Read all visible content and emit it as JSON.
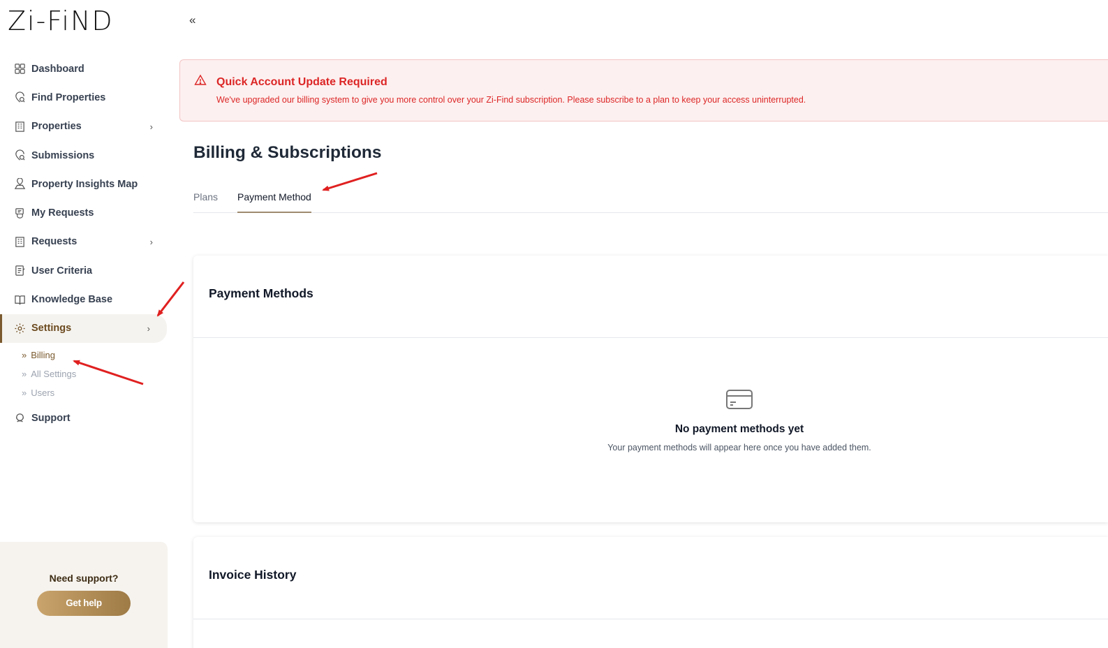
{
  "app": {
    "logo": "Zi-FiND"
  },
  "sidebar": {
    "items": [
      {
        "label": "Dashboard",
        "icon": "grid-icon",
        "chevron": false
      },
      {
        "label": "Find Properties",
        "icon": "location-search-icon",
        "chevron": false
      },
      {
        "label": "Properties",
        "icon": "building-icon",
        "chevron": true
      },
      {
        "label": "Submissions",
        "icon": "location-search-icon",
        "chevron": false
      },
      {
        "label": "Property Insights Map",
        "icon": "map-icon",
        "chevron": false
      },
      {
        "label": "My Requests",
        "icon": "request-icon",
        "chevron": false
      },
      {
        "label": "Requests",
        "icon": "building-icon",
        "chevron": true
      },
      {
        "label": "User Criteria",
        "icon": "criteria-icon",
        "chevron": false
      },
      {
        "label": "Knowledge Base",
        "icon": "book-icon",
        "chevron": false
      },
      {
        "label": "Settings",
        "icon": "gear-icon",
        "chevron": true,
        "active": true
      }
    ],
    "chevron_glyph": "›",
    "sub_prefix": "»",
    "settings_sub": [
      {
        "label": "Billing",
        "active": true
      },
      {
        "label": "All Settings"
      },
      {
        "label": "Users"
      }
    ],
    "support_item": {
      "label": "Support",
      "icon": "support-icon"
    },
    "support_box": {
      "title": "Need support?",
      "button": "Get help"
    }
  },
  "topbar": {
    "collapse_glyph": "«"
  },
  "alert": {
    "title": "Quick Account Update Required",
    "text": "We've upgraded our billing system to give you more control over your Zi-Find subscription. Please subscribe to a plan to keep your access uninterrupted."
  },
  "page": {
    "title": "Billing & Subscriptions",
    "tabs": [
      {
        "label": "Plans",
        "active": false
      },
      {
        "label": "Payment Method",
        "active": true
      }
    ]
  },
  "payment_methods": {
    "title": "Payment Methods",
    "empty_title": "No payment methods yet",
    "empty_text": "Your payment methods will appear here once you have added them."
  },
  "invoice_history": {
    "title": "Invoice History"
  },
  "colors": {
    "accent": "#7a5a2e",
    "alert_red": "#dc2626",
    "alert_bg": "#fdf0f0",
    "annotation_arrow": "#e02020"
  }
}
